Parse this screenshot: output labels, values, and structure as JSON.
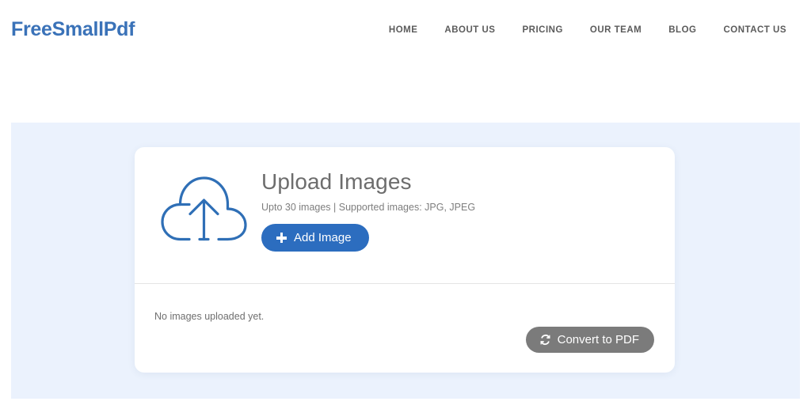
{
  "header": {
    "brand": "FreeSmallPdf",
    "nav": [
      {
        "label": "HOME"
      },
      {
        "label": "ABOUT US"
      },
      {
        "label": "PRICING"
      },
      {
        "label": "OUR TEAM"
      },
      {
        "label": "BLOG"
      },
      {
        "label": "CONTACT US"
      }
    ]
  },
  "upload_card": {
    "icon": "cloud-upload-icon",
    "title": "Upload Images",
    "subtitle": "Upto 30 images | Supported images: JPG, JPEG",
    "add_button": {
      "label": "Add Image",
      "icon": "plus-icon"
    },
    "empty_message": "No images uploaded yet.",
    "convert_button": {
      "label": "Convert to PDF",
      "icon": "sync-icon"
    }
  },
  "colors": {
    "brand_blue": "#3a72b8",
    "button_blue": "#2c6dbf",
    "hero_background": "#ebf2fd",
    "card_background": "#ffffff",
    "convert_gray": "#7b7b7b",
    "nav_text": "#5b5b5b",
    "heading_gray": "#6d6d6d"
  }
}
